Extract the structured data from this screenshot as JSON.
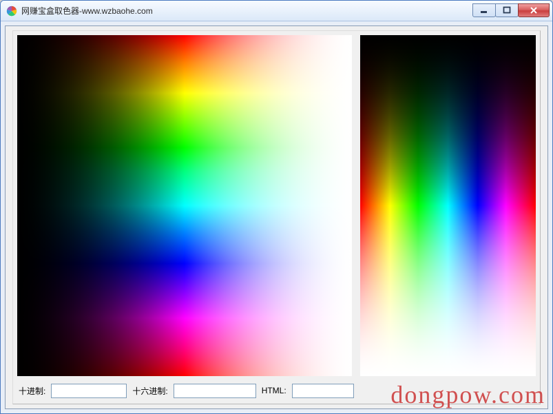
{
  "window": {
    "title": "网赚宝盒取色器-www.wzbaohe.com"
  },
  "labels": {
    "decimal": "十进制:",
    "hex": "十六进制:",
    "html": "HTML:"
  },
  "values": {
    "decimal": "",
    "hex": "",
    "html": ""
  },
  "watermark": "dongpow.com"
}
